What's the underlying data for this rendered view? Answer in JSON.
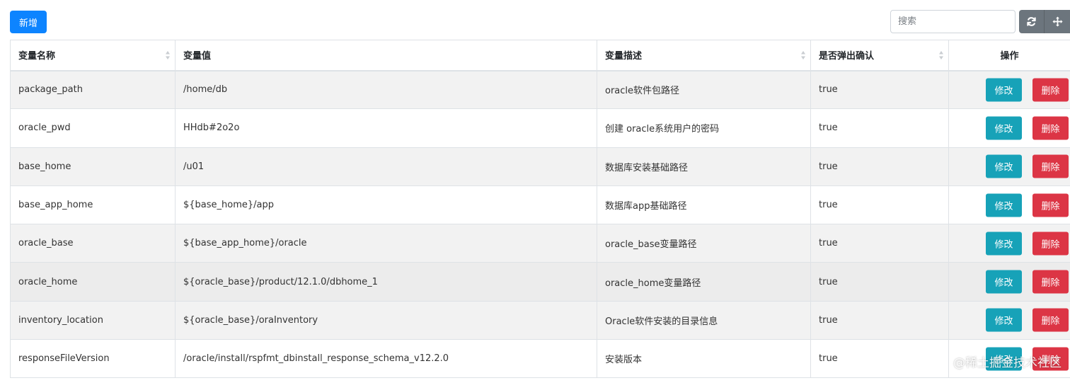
{
  "toolbar": {
    "add_label": "新增",
    "search_placeholder": "搜索",
    "refresh_icon": "refresh-icon",
    "move_icon": "move-icon"
  },
  "table": {
    "columns": [
      "变量名称",
      "变量值",
      "变量描述",
      "是否弹出确认",
      "操作"
    ],
    "rows": [
      {
        "name": "package_path",
        "value": "/home/db",
        "desc": "oracle软件包路径",
        "confirm": "true",
        "edit": "修改",
        "delete": "删除"
      },
      {
        "name": "oracle_pwd",
        "value": "HHdb#2o2o",
        "desc": "创建 oracle系统用户的密码",
        "confirm": "true",
        "edit": "修改",
        "delete": "删除"
      },
      {
        "name": "base_home",
        "value": "/u01",
        "desc": "数据库安装基础路径",
        "confirm": "true",
        "edit": "修改",
        "delete": "删除"
      },
      {
        "name": "base_app_home",
        "value": "${base_home}/app",
        "desc": "数据库app基础路径",
        "confirm": "true",
        "edit": "修改",
        "delete": "删除"
      },
      {
        "name": "oracle_base",
        "value": "${base_app_home}/oracle",
        "desc": "oracle_base变量路径",
        "confirm": "true",
        "edit": "修改",
        "delete": "删除"
      },
      {
        "name": "oracle_home",
        "value": "${oracle_base}/product/12.1.0/dbhome_1",
        "desc": "oracle_home变量路径",
        "confirm": "true",
        "edit": "修改",
        "delete": "删除"
      },
      {
        "name": "inventory_location",
        "value": "${oracle_base}/oraInventory",
        "desc": "Oracle软件安装的目录信息",
        "confirm": "true",
        "edit": "修改",
        "delete": "删除"
      },
      {
        "name": "responseFileVersion",
        "value": "/oracle/install/rspfmt_dbinstall_response_schema_v12.2.0",
        "desc": "安装版本",
        "confirm": "true",
        "edit": "修改",
        "delete": "删除"
      }
    ]
  },
  "watermark": "@稀土掘金技术社区",
  "colors": {
    "primary": "#0d84ff",
    "info": "#17a2b8",
    "danger": "#dc3545",
    "secondary": "#6c757d"
  }
}
